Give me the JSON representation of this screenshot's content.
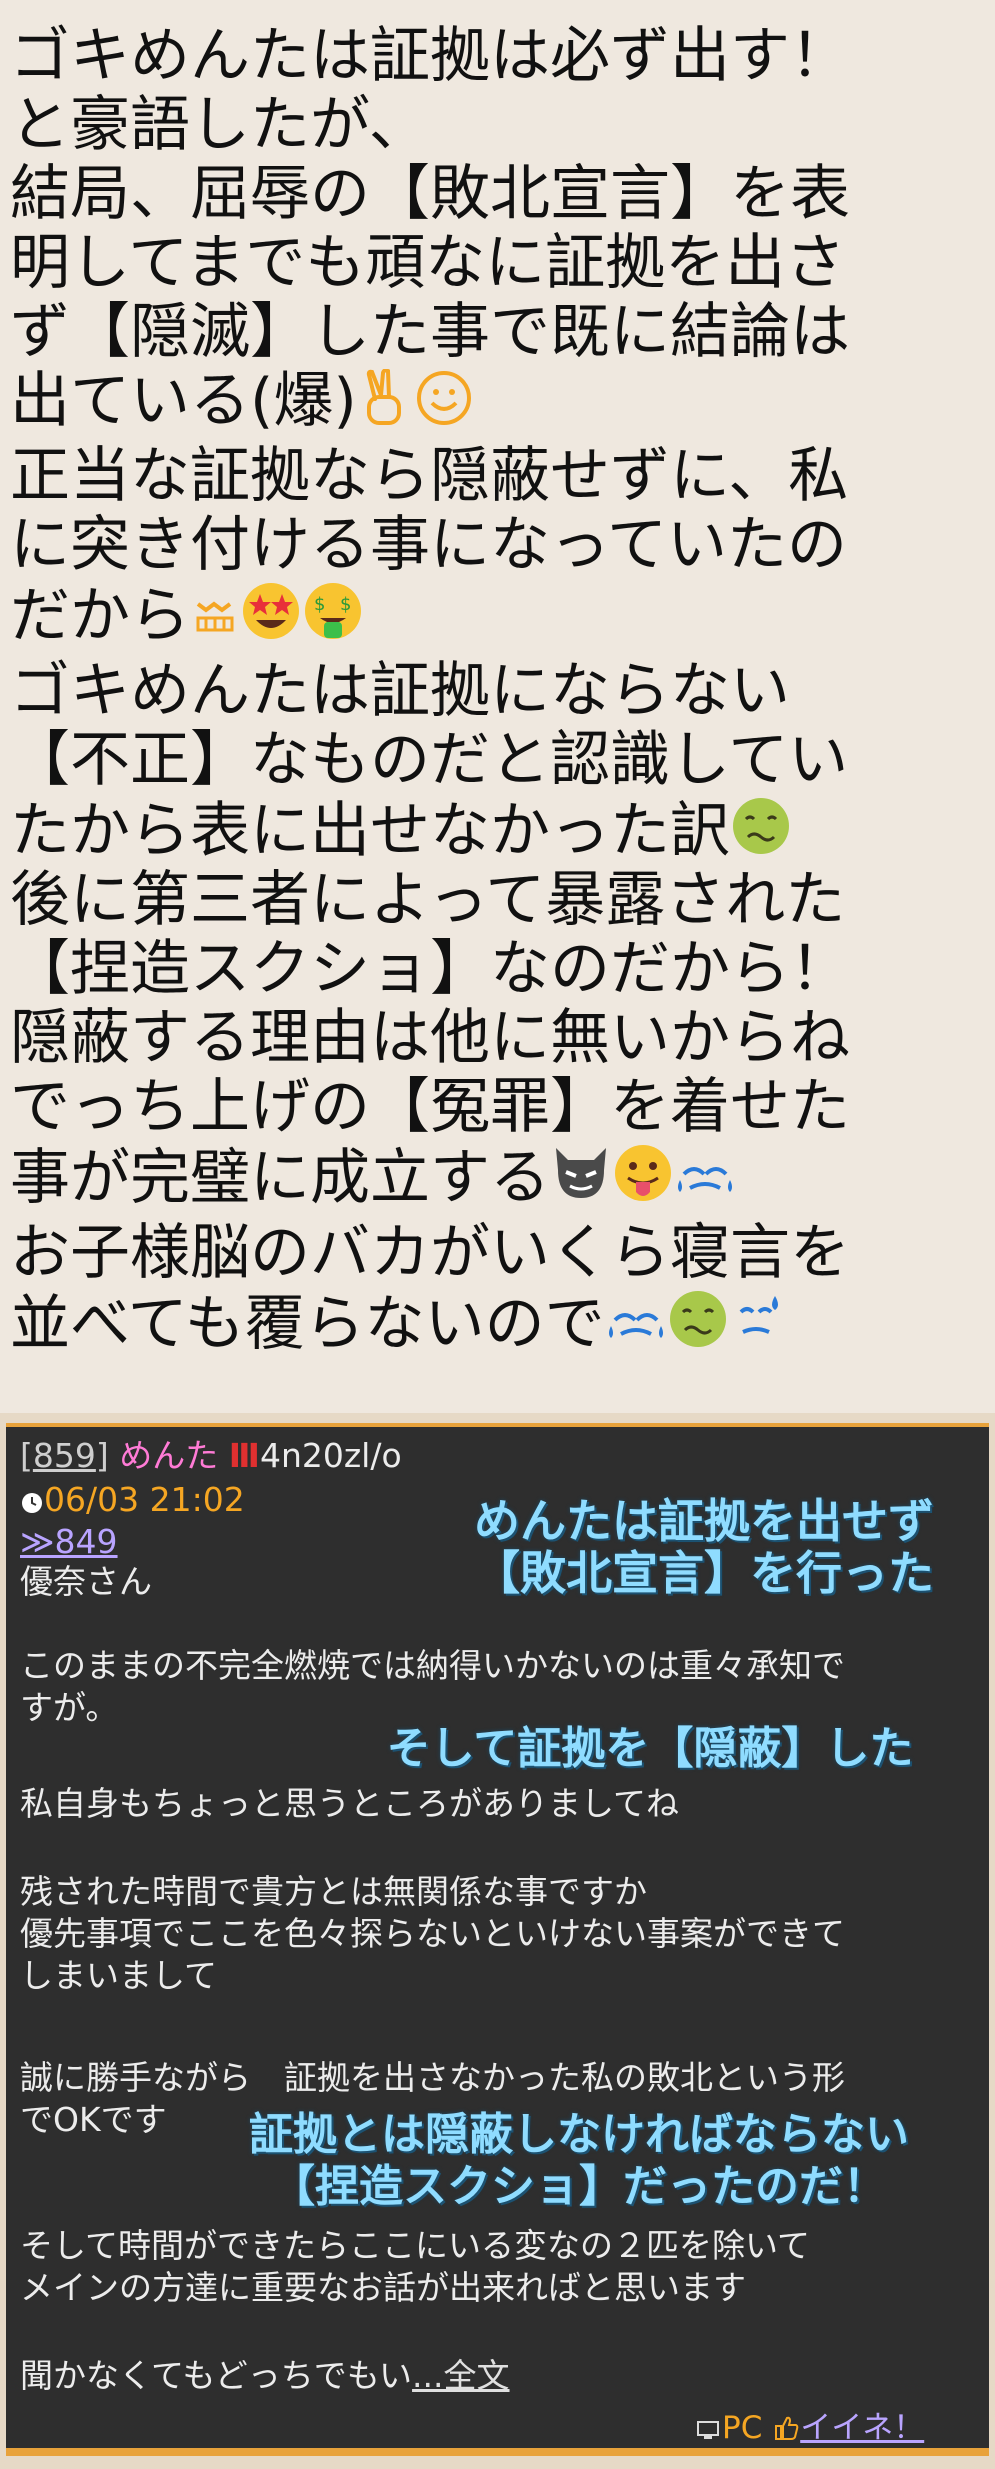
{
  "top_text": {
    "p1": {
      "line1": "ゴキめんたは証拠は必ず出す！",
      "line2": "と豪語したが、",
      "line3": "結局、屈辱の【敗北宣言】を表",
      "line4": "明してまでも頑なに証拠を出さ",
      "line5": "ず【隠滅】した事で既に結論は",
      "line6": "出ている(爆)"
    },
    "p2": {
      "line1": "正当な証拠なら隠蔽せずに、私",
      "line2": "に突き付ける事になっていたの",
      "line3": "だから"
    },
    "p3": {
      "line1": "ゴキめんたは証拠にならない",
      "line2": "【不正】なものだと認識してい",
      "line3": "たから表に出せなかった訳",
      "line4": "後に第三者によって暴露された",
      "line5": "【捏造スクショ】なのだから！",
      "line6": "隠蔽する理由は他に無いからね",
      "line7": "でっち上げの【冤罪】を着せた",
      "line8": "事が完璧に成立する"
    },
    "p4": {
      "line1": "お子様脳のバカがいくら寝言を",
      "line2": "並べても覆らないので"
    }
  },
  "post": {
    "number": "859",
    "name": "めんた",
    "id": "4n20zl/o",
    "datetime": "06/03 21:02",
    "reply_to": "≫849",
    "greeting": "優奈さん",
    "body1_line1": "このままの不完全燃焼では納得いかないのは重々承知で",
    "body1_line2": "すが。",
    "body2": "私自身もちょっと思うところがありましてね",
    "body3_line1": "残された時間で貴方とは無関係な事ですか",
    "body3_line2": "優先事項でここを色々探らないといけない事案ができて",
    "body3_line3": "しまいまして",
    "body4_line1": "誠に勝手ながら　証拠を出さなかった私の敗北という形",
    "body4_line2": "でOKです",
    "body5_line1": "そして時間ができたらここにいる変なの２匹を除いて",
    "body5_line2": "メインの方達に重要なお話が出来ればと思います",
    "body6": "聞かなくてもどっちでもい",
    "more_link": "...全文",
    "pc_label": "PC",
    "like_link": "イイネ！"
  },
  "overlays": {
    "o1_line1": "めんたは証拠を出せず",
    "o1_line2": "【敗北宣言】を行った",
    "o2": "そして証拠を【隠蔽】した",
    "o3_line1": "証拠とは隠蔽しなければならない",
    "o3_line2": "【捏造スクショ】だったのだ！"
  },
  "colors": {
    "background": "#efe8df",
    "post_background": "#2e2e2e",
    "accent_orange": "#f5a623",
    "overlay_text": "#8fdcff",
    "link_purple": "#b9a4ff",
    "name_pink": "#ff7bd6"
  },
  "icons": [
    "victory-hand-icon",
    "smiley-icon",
    "grimace-icon",
    "star-eyes-icon",
    "money-face-icon",
    "nauseated-face-icon",
    "devil-icon",
    "tongue-face-icon",
    "sweat-icon",
    "clock-icon",
    "pc-icon",
    "thumbs-up-icon"
  ]
}
